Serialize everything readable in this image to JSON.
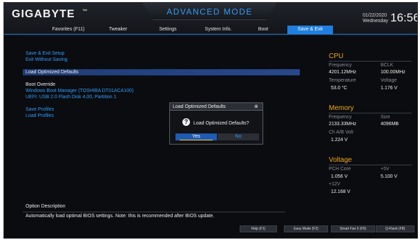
{
  "header": {
    "brand": "GIGABYTE",
    "brand_mark": "™",
    "mode": "ADVANCED MODE",
    "date": "01/22/2020",
    "day": "Wednesday",
    "time": "16:56"
  },
  "tabs": [
    {
      "label": "Favorites (F11)",
      "active": false
    },
    {
      "label": "Tweaker",
      "active": false
    },
    {
      "label": "Settings",
      "active": false
    },
    {
      "label": "System Info.",
      "active": false
    },
    {
      "label": "Boot",
      "active": false
    },
    {
      "label": "Save & Exit",
      "active": true
    }
  ],
  "menu": {
    "save_exit_setup": "Save & Exit Setup",
    "exit_without_saving": "Exit Without Saving",
    "load_optimized_defaults": "Load Optimized Defaults",
    "boot_override_header": "Boot Override",
    "boot_option_1": "Windows Boot Manager (TOSHIBA DT01ACA100)",
    "boot_option_2": "UEFI: USB 2.0 Flash Disk 4.00, Partition 1",
    "save_profiles": "Save Profiles",
    "load_profiles": "Load Profiles"
  },
  "dialog": {
    "title": "Load Optimized Defaults",
    "close": "⊗",
    "icon": "?",
    "message": "Load Optimized Defaults?",
    "yes": "Yes",
    "no": "No"
  },
  "cpu": {
    "title": "CPU",
    "frequency_label": "Frequency",
    "frequency_value": "4201.12MHz",
    "bclk_label": "BCLK",
    "bclk_value": "100.00MHz",
    "temperature_label": "Temperature",
    "temperature_value": "53.0 °C",
    "voltage_label": "Voltage",
    "voltage_value": "1.176 V"
  },
  "memory": {
    "title": "Memory",
    "frequency_label": "Frequency",
    "frequency_value": "2133.33MHz",
    "size_label": "Size",
    "size_value": "4096MB",
    "volt_label": "Ch A/B Volt",
    "volt_value": "1.224 V"
  },
  "voltage": {
    "title": "Voltage",
    "pch_label": "PCH Core",
    "pch_value": "1.056 V",
    "p5v_label": "+5V",
    "p5v_value": "5.100 V",
    "p12v_label": "+12V",
    "p12v_value": "12.168 V"
  },
  "description": {
    "header": "Option Description",
    "text": "Automatically load optimal BIOS settings. Note: this is recommended after BIOS update."
  },
  "footer": {
    "help": "Help (F1)",
    "easy_mode": "Easy Mode (F2)",
    "smart_fan": "Smart Fan 5 (F6)",
    "qflash": "Q-Flash (F8)"
  },
  "colors": {
    "accent": "#2f9dfc",
    "tab_active": "#1f7fe0",
    "section_title": "#f0a81e",
    "background": "#0b0c10"
  }
}
